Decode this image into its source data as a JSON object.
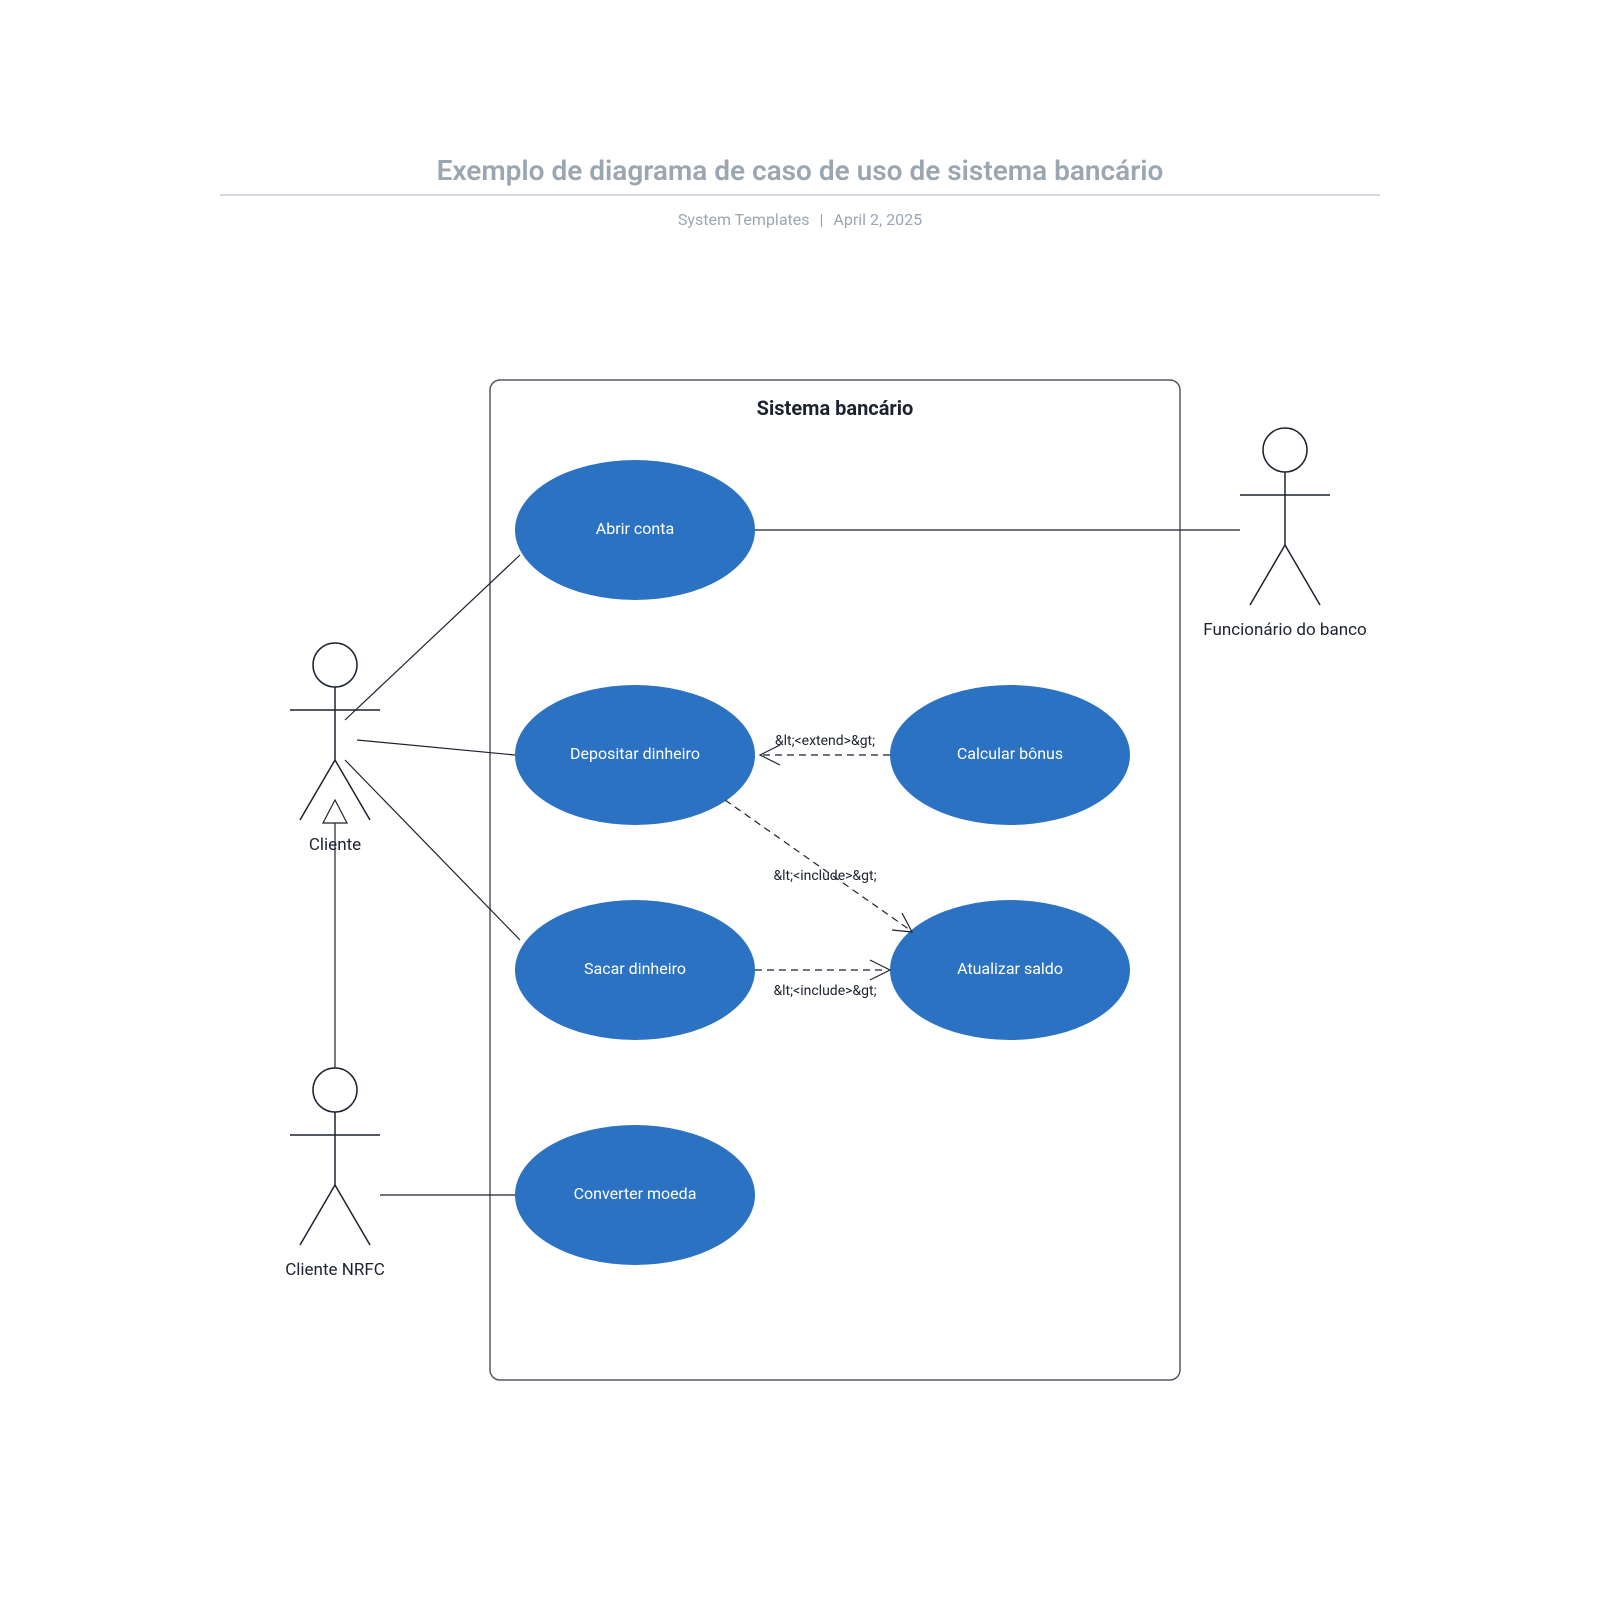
{
  "header": {
    "title": "Exemplo de diagrama de caso de uso de sistema bancário",
    "source": "System Templates",
    "date": "April 2, 2025"
  },
  "system": {
    "name": "Sistema bancário"
  },
  "actors": {
    "cliente": "Cliente",
    "cliente_nrfc": "Cliente NRFC",
    "funcionario": "Funcionário do banco"
  },
  "usecases": {
    "abrir_conta": "Abrir conta",
    "depositar": "Depositar dinheiro",
    "sacar": "Sacar dinheiro",
    "converter": "Converter moeda",
    "calcular_bonus": "Calcular bônus",
    "atualizar_saldo": "Atualizar saldo"
  },
  "relations": {
    "extend": "&lt;<extend>&gt;",
    "include": "&lt;<include>&gt;"
  }
}
